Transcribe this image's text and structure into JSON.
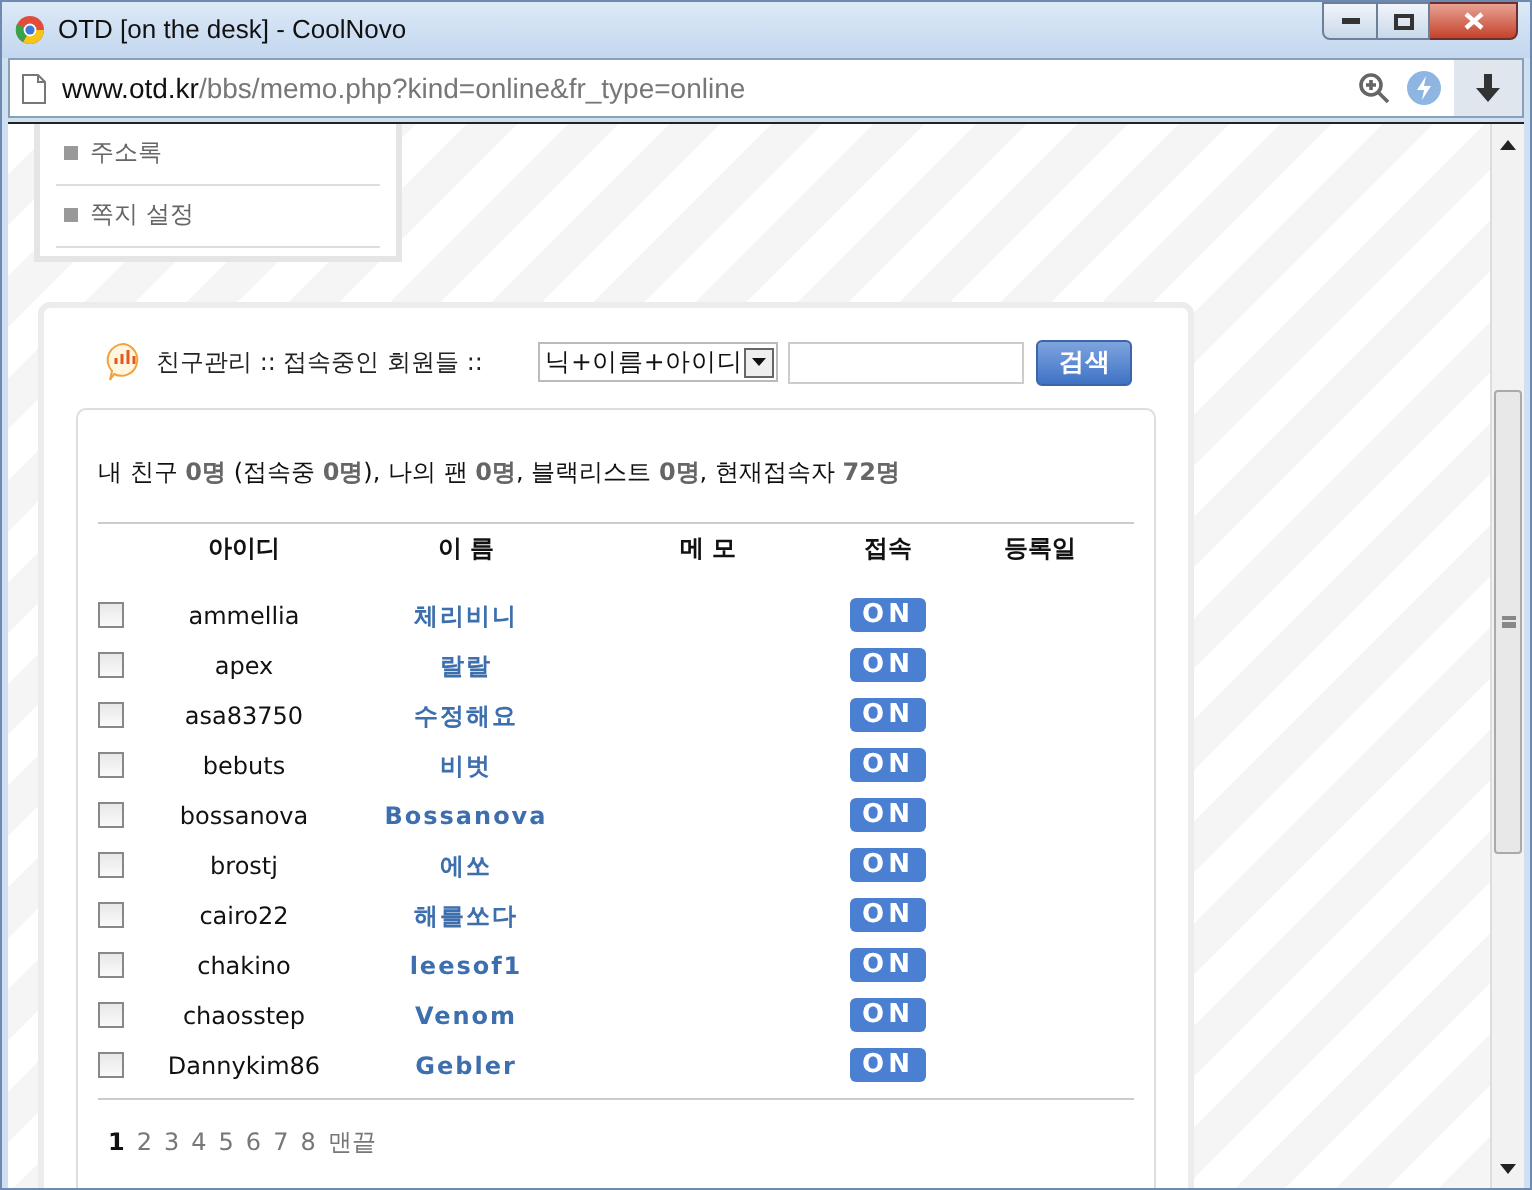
{
  "window": {
    "title": "OTD [on the desk] - CoolNovo"
  },
  "address": {
    "host": "www.otd.kr",
    "path": "/bbs/memo.php?kind=online&fr_type=online"
  },
  "sidebar": {
    "items": [
      {
        "label": "주소록"
      },
      {
        "label": "쪽지 설정"
      }
    ]
  },
  "panel": {
    "title": "친구관리 :: 접속중인 회원들 ::",
    "search_select": "닉+이름+아이디",
    "search_button": "검색",
    "summary": "내 친구 **0명** (접속중 **0명**), 나의 팬 **0명**, 블랙리스트 **0명**, 현재접속자 **72명**"
  },
  "table": {
    "columns": [
      "아이디",
      "이 름",
      "메 모",
      "접속",
      "등록일"
    ],
    "rows": [
      {
        "checked": false,
        "id": "ammellia",
        "name": "체리비니",
        "status": "ON"
      },
      {
        "checked": false,
        "id": "apex",
        "name": "랄랄",
        "status": "ON"
      },
      {
        "checked": false,
        "id": "asa83750",
        "name": "수정해요",
        "status": "ON"
      },
      {
        "checked": false,
        "id": "bebuts",
        "name": "비벗",
        "status": "ON"
      },
      {
        "checked": false,
        "id": "bossanova",
        "name": "Bossanova",
        "status": "ON"
      },
      {
        "checked": false,
        "id": "brostj",
        "name": "에쏘",
        "status": "ON"
      },
      {
        "checked": false,
        "id": "cairo22",
        "name": "해를쏘다",
        "status": "ON"
      },
      {
        "checked": false,
        "id": "chakino",
        "name": "leesof1",
        "status": "ON"
      },
      {
        "checked": false,
        "id": "chaosstep",
        "name": "Venom",
        "status": "ON"
      },
      {
        "checked": false,
        "id": "Dannykim86",
        "name": "Gebler",
        "status": "ON"
      }
    ]
  },
  "pagination": {
    "pages": [
      {
        "label": "1",
        "selected": true
      },
      {
        "label": "2",
        "selected": false
      },
      {
        "label": "3",
        "selected": false
      },
      {
        "label": "4",
        "selected": false
      },
      {
        "label": "5",
        "selected": false
      },
      {
        "label": "6",
        "selected": false
      },
      {
        "label": "7",
        "selected": false
      },
      {
        "label": "8",
        "selected": false
      }
    ],
    "last": "맨끝"
  }
}
